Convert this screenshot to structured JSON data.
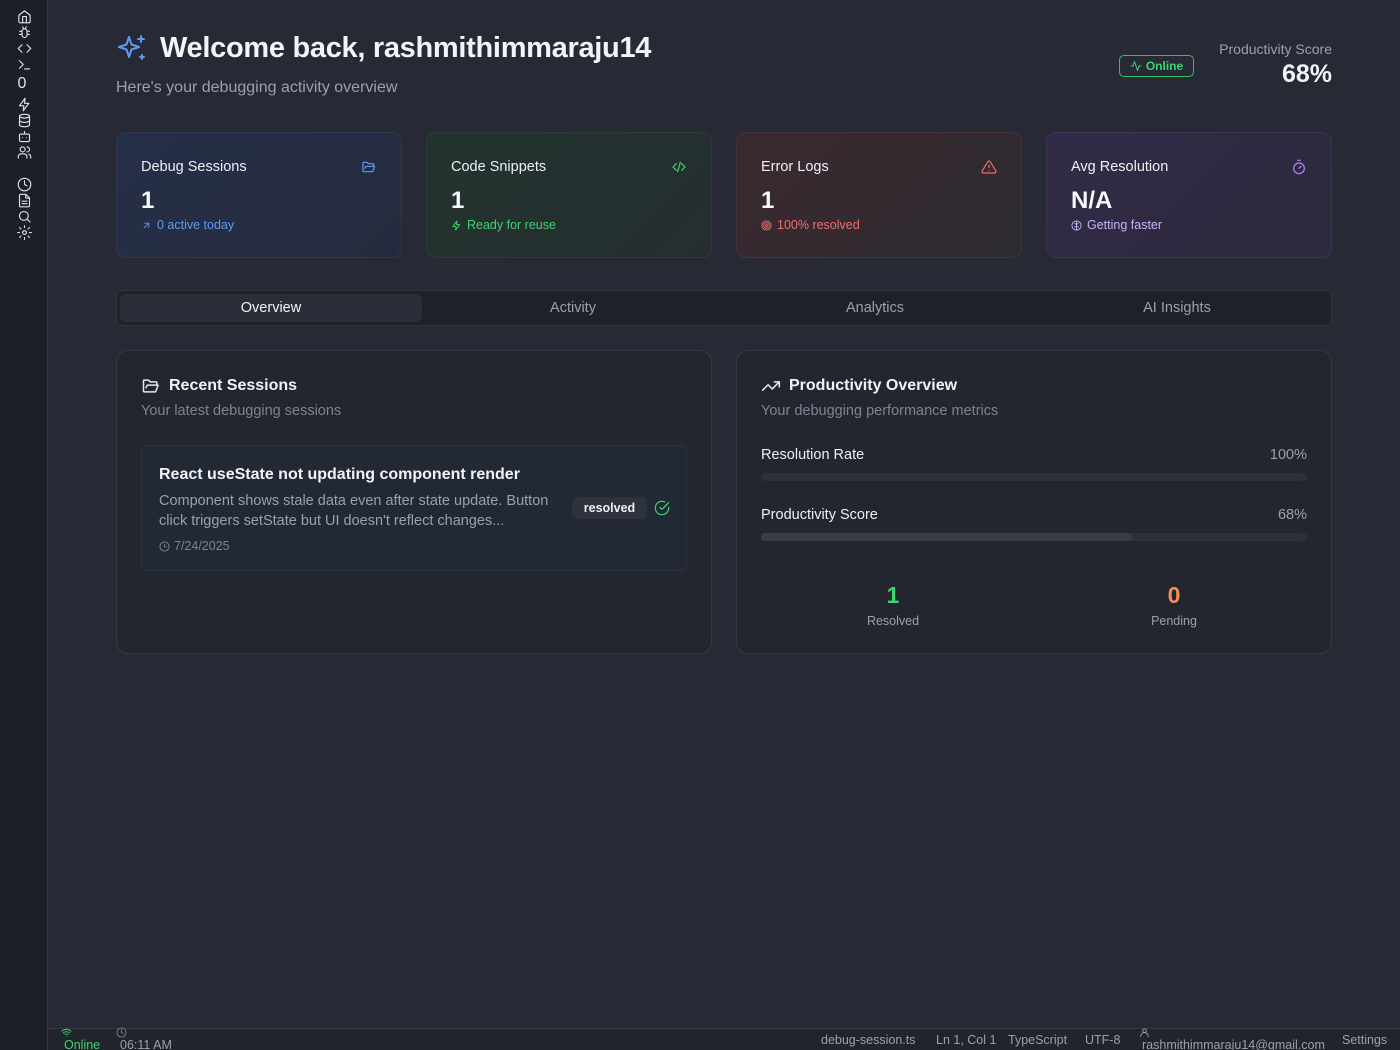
{
  "sidebar": {
    "icons": [
      "home-icon",
      "bug-icon",
      "code-icon",
      "terminal-icon",
      "zero-icon",
      "zap-icon",
      "database-icon",
      "bot-icon",
      "users-icon",
      "clock-icon",
      "file-icon",
      "search-icon",
      "gear-icon"
    ],
    "zero_glyph": "0"
  },
  "header": {
    "title": "Welcome back, rashmithimmaraju14",
    "subtitle": "Here's your debugging activity overview",
    "status": "Online",
    "productivity_label": "Productivity Score",
    "productivity_value": "68%"
  },
  "stats": [
    {
      "title": "Debug Sessions",
      "value": "1",
      "sub": "0 active today",
      "icon": "folder-open-icon",
      "accent": "#5b9bf5"
    },
    {
      "title": "Code Snippets",
      "value": "1",
      "sub": "Ready for reuse",
      "icon": "code-icon",
      "accent": "#3fd36e"
    },
    {
      "title": "Error Logs",
      "value": "1",
      "sub": "100% resolved",
      "icon": "alert-triangle-icon",
      "accent": "#f26d6d"
    },
    {
      "title": "Avg Resolution",
      "value": "N/A",
      "sub": "Getting faster",
      "icon": "timer-icon",
      "accent": "#b784f7"
    }
  ],
  "tabs": [
    {
      "label": "Overview",
      "active": true
    },
    {
      "label": "Activity",
      "active": false
    },
    {
      "label": "Analytics",
      "active": false
    },
    {
      "label": "AI Insights",
      "active": false
    }
  ],
  "recent_sessions": {
    "title": "Recent Sessions",
    "subtitle": "Your latest debugging sessions",
    "items": [
      {
        "title": "React useState not updating component render",
        "description": "Component shows stale data even after state update. Button click triggers setState but UI doesn't reflect changes...",
        "date": "7/24/2025",
        "status": "resolved"
      }
    ]
  },
  "productivity_overview": {
    "title": "Productivity Overview",
    "subtitle": "Your debugging performance metrics",
    "metrics": [
      {
        "label": "Resolution Rate",
        "display": "100%",
        "value": 1.0
      },
      {
        "label": "Productivity Score",
        "display": "68%",
        "value": 0.68
      }
    ],
    "counts": [
      {
        "value": "1",
        "label": "Resolved",
        "color": "#3fd36e"
      },
      {
        "value": "0",
        "label": "Pending",
        "color": "#f58b5b"
      }
    ]
  },
  "statusbar": {
    "connection": "Online",
    "time": "06:11 AM",
    "file": "debug-session.ts",
    "cursor": "Ln 1, Col 1",
    "language": "TypeScript",
    "encoding": "UTF-8",
    "user": "rashmithimmaraju14@gmail.com",
    "settings": "Settings"
  }
}
